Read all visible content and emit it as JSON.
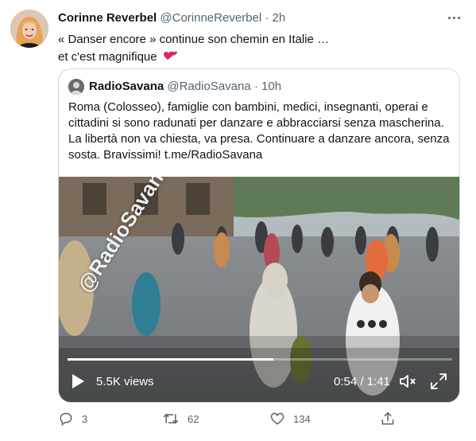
{
  "tweet": {
    "author_name": "Corinne Reverbel",
    "author_handle": "@CorinneReverbel",
    "separator": "·",
    "time": "2h",
    "text_line1": "« Danser encore » continue son chemin en Italie …",
    "text_line2": "et c'est magnifique",
    "emoji_icon": "two-hearts-emoji"
  },
  "quoted": {
    "author_name": "RadioSavana",
    "author_handle": "@RadioSavana",
    "separator": "·",
    "time": "10h",
    "text_line1": "Roma (Colosseo), famiglie con bambini, medici, insegnanti, operai e",
    "text_line2": "cittadini si sono radunati per danzare e abbracciarsi senza mascherina.",
    "text_line3": "La libertà non va chiesta, va presa. Continuare a danzare ancora, senza",
    "text_line4": "sosta. Bravissimi! t.me/RadioSavana",
    "video": {
      "watermark": "@RadioSavana",
      "views": "5.5K views",
      "timer": "0:54 / 1:41",
      "progress_fraction": 0.535,
      "icons": [
        "play-icon",
        "volume-icon",
        "fullscreen-icon"
      ]
    }
  },
  "actions": {
    "reply_count": "3",
    "retweet_count": "62",
    "like_count": "134",
    "icons": [
      "reply-icon",
      "retweet-icon",
      "like-icon",
      "share-icon"
    ]
  },
  "colors": {
    "text_primary": "#0f1419",
    "text_secondary": "#536471",
    "border": "#cfd9de",
    "heart_emoji": "#e0245e"
  }
}
